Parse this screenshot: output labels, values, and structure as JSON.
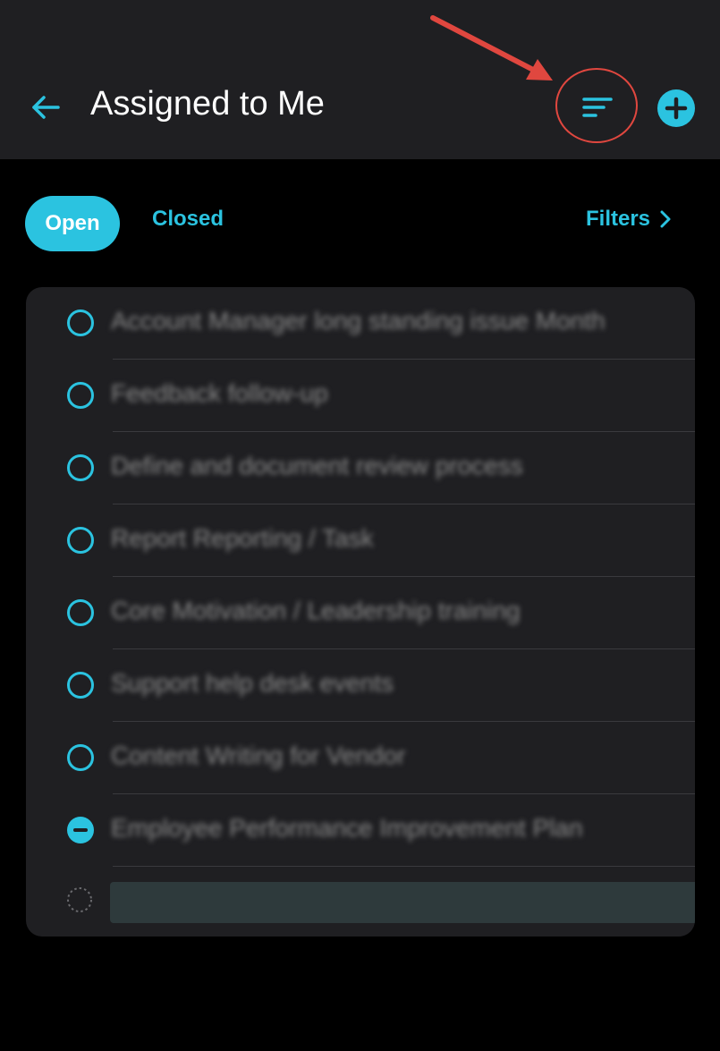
{
  "header": {
    "title": "Assigned to Me",
    "back_icon": "arrow-left-icon",
    "sort_icon": "sort-lines-icon",
    "add_icon": "plus-circle-icon"
  },
  "tabs": {
    "open_label": "Open",
    "closed_label": "Closed",
    "filters_label": "Filters"
  },
  "tasks": [
    {
      "title": "Account Manager long standing issue Month",
      "status": "open"
    },
    {
      "title": "Feedback follow-up",
      "status": "open"
    },
    {
      "title": "Define and document review process",
      "status": "open"
    },
    {
      "title": "Report Reporting / Task",
      "status": "open"
    },
    {
      "title": "Core Motivation / Leadership training",
      "status": "open"
    },
    {
      "title": "Support help desk events",
      "status": "open"
    },
    {
      "title": "Content Writing for Vendor",
      "status": "open"
    },
    {
      "title": "Employee Performance Improvement Plan",
      "status": "in-progress"
    }
  ],
  "new_task": {
    "placeholder": ""
  },
  "colors": {
    "accent": "#2bc3e0",
    "header_bg": "#1f1f22",
    "card_bg": "#1f1f22",
    "page_bg": "#000000",
    "annotation": "#e0473f"
  }
}
